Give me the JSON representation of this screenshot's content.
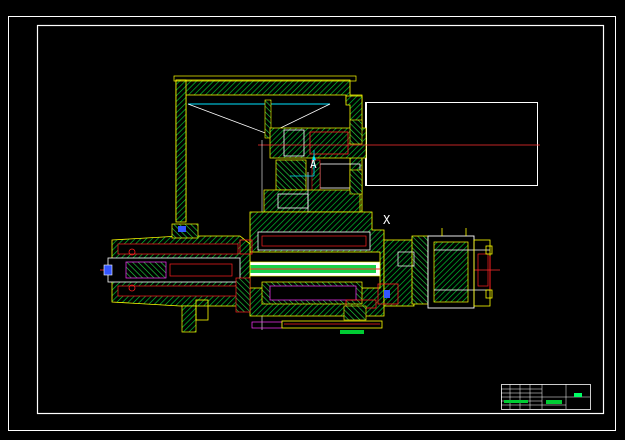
{
  "drawing": {
    "labels": {
      "section_a": "A",
      "axis_x": "X"
    }
  },
  "colors": {
    "background": "#000000",
    "frame": "#ffffff",
    "hatch": "#00cc33",
    "outline": "#ffff00",
    "part_red": "#ff2020",
    "centerline": "#ff3030",
    "dim_cyan": "#00e5ff",
    "part_magenta": "#ff33ff",
    "part_blue": "#3355ff",
    "title_green": "#00ff66"
  }
}
